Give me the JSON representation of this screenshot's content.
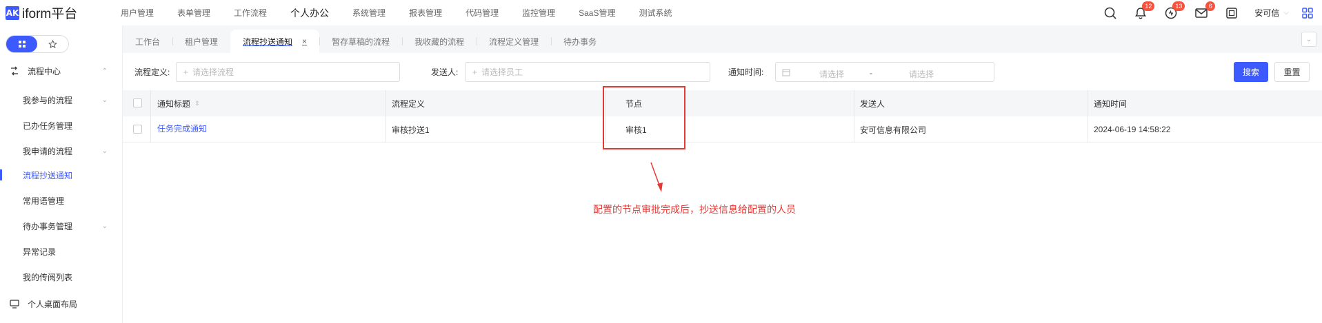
{
  "app": {
    "logo_mark": "AK",
    "logo_text": "iform平台"
  },
  "topmenu": [
    {
      "label": "用户管理"
    },
    {
      "label": "表单管理"
    },
    {
      "label": "工作流程"
    },
    {
      "label": "个人办公"
    },
    {
      "label": "系统管理"
    },
    {
      "label": "报表管理"
    },
    {
      "label": "代码管理"
    },
    {
      "label": "监控管理"
    },
    {
      "label": "SaaS管理"
    },
    {
      "label": "测试系统"
    }
  ],
  "topright": {
    "notify_badge": "12",
    "activity_badge": "13",
    "mail_badge": "6",
    "user_name": "安可信"
  },
  "sidebar": {
    "group_title": "流程中心",
    "items": [
      {
        "label": "我参与的流程"
      },
      {
        "label": "已办任务管理"
      },
      {
        "label": "我申请的流程"
      },
      {
        "label": "流程抄送通知"
      },
      {
        "label": "常用语管理"
      },
      {
        "label": "待办事务管理"
      },
      {
        "label": "异常记录"
      },
      {
        "label": "我的传阅列表"
      }
    ],
    "bottom_group": "个人桌面布局"
  },
  "tabs": [
    {
      "label": "工作台"
    },
    {
      "label": "租户管理"
    },
    {
      "label": "流程抄送通知"
    },
    {
      "label": "暂存草稿的流程"
    },
    {
      "label": "我收藏的流程"
    },
    {
      "label": "流程定义管理"
    },
    {
      "label": "待办事务"
    }
  ],
  "filter": {
    "def_label": "流程定义:",
    "def_placeholder": "请选择流程",
    "sender_label": "发送人:",
    "sender_placeholder": "请选择员工",
    "time_label": "通知时间:",
    "start_placeholder": "请选择",
    "range_sep": "-",
    "end_placeholder": "请选择",
    "search_btn": "搜索",
    "reset_btn": "重置"
  },
  "table": {
    "headers": [
      "通知标题",
      "流程定义",
      "节点",
      "发送人",
      "通知时间"
    ],
    "rows": [
      {
        "title": "任务完成通知",
        "definition": "审核抄送1",
        "node": "审核1",
        "sender": "安可信息有限公司",
        "time": "2024-06-19 14:58:22"
      }
    ]
  },
  "annotation": {
    "note": "配置的节点审批完成后，抄送信息给配置的人员"
  },
  "colors": {
    "accent": "#3d5afe",
    "annotation": "#e53935",
    "badge": "#f5533d"
  }
}
